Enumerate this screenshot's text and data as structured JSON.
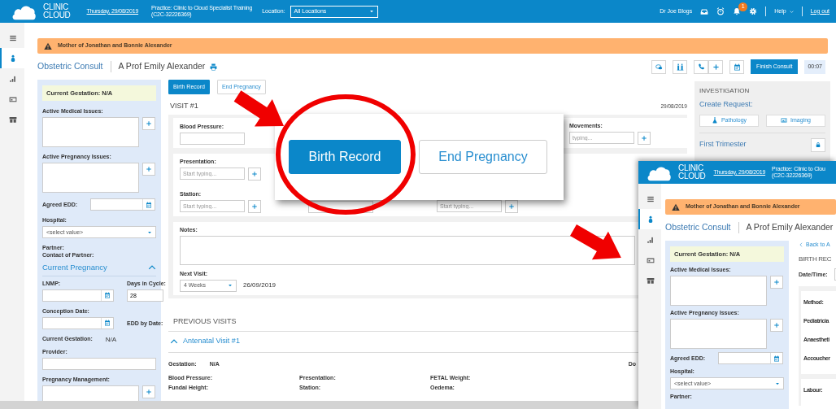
{
  "main": {
    "header": {
      "logo": [
        "CLINIC",
        "CLOUD"
      ],
      "date": "Thursday, 29/08/2019",
      "practice": [
        "Practice: Clinic to Cloud Specialist Training",
        "(C2C-32226369)"
      ],
      "location_label": "Location:",
      "location_value": "All Locations",
      "user": "Dr Joe Blogs",
      "notification_count": "1",
      "help": "Help",
      "logout": "Log out"
    },
    "side_nav": [
      {
        "kind": "menu",
        "selected": false
      },
      {
        "kind": "patient",
        "selected": true
      },
      {
        "kind": "chart",
        "selected": false
      },
      {
        "kind": "card",
        "selected": false
      },
      {
        "kind": "gift",
        "selected": false
      }
    ],
    "alert": "Mother of Jonathan and Bonnie Alexander",
    "consult": {
      "title": "Obstetric Consult",
      "patient": "A Prof Emily Alexander",
      "finish_button": "Finish Consult",
      "timer": "00:07"
    },
    "summary_panel": {
      "gestation": "Current Gestation: N/A",
      "items": [
        {
          "kind": "textarea",
          "label": "Active Medical Issues:"
        },
        {
          "kind": "textarea",
          "label": "Active Pregnancy Issues:"
        },
        {
          "kind": "date",
          "label": "Agreed EDD:"
        },
        {
          "kind": "select",
          "label": "Hospital:",
          "value": "<select value>"
        },
        {
          "kind": "label",
          "label": "Partner:"
        },
        {
          "kind": "label",
          "label": "Contact of Partner:"
        },
        {
          "kind": "section",
          "label": "Current Pregnancy",
          "expanded": true
        },
        {
          "kind": "pair",
          "label": "LNMP:",
          "label_2": "Days in Cycle:",
          "value": "28"
        },
        {
          "kind": "date_note",
          "label": "Conception Date:",
          "note": "EDD by Date:"
        },
        {
          "kind": "info",
          "label": "Current Gestation:",
          "value": "N/A"
        },
        {
          "kind": "text",
          "label": "Provider:"
        },
        {
          "kind": "textarea",
          "label": "Pregnancy Management:"
        }
      ]
    },
    "actions": [
      {
        "label": "Birth Record",
        "kind": "primary"
      },
      {
        "label": "End Pregnancy",
        "kind": "outline"
      }
    ],
    "visit": {
      "title": "VISIT #1",
      "date": "29/08/2019",
      "blocks": [
        {
          "kind": "grid",
          "rows": [
            [
              {
                "kind": "text",
                "label": "Blood Pressure:"
              },
              null,
              null,
              {
                "kind": "search",
                "label": "Movements:",
                "placeholder": "typing..."
              }
            ]
          ]
        },
        {
          "kind": "grid",
          "rows": [
            [
              {
                "kind": "search",
                "label": "Presentation:",
                "placeholder": "Start typing..."
              },
              null,
              null,
              null
            ],
            [
              {
                "kind": "search",
                "label": "Station:",
                "placeholder": "Start typing..."
              },
              {
                "kind": "text"
              },
              {
                "kind": "search",
                "placeholder": "Start typing..."
              },
              null
            ]
          ]
        },
        {
          "kind": "notes",
          "notes_label": "Notes:",
          "next_label": "Next Visit:",
          "next_value": "4 Weeks",
          "next_date": "26/09/2019"
        }
      ]
    },
    "previous_visits": {
      "title": "PREVIOUS VISITS",
      "visits": [
        {
          "title": "Antenatal Visit #1",
          "expanded": true,
          "gestation_label": "Gestation:",
          "gestation_value": "N/A",
          "side_text": "Do",
          "fields": [
            "Blood Pressure:",
            "Presentation:",
            "FETAL Weight:",
            "Fundal Height:",
            "Station:",
            "Oedema:"
          ]
        }
      ]
    },
    "investigation": {
      "title": "INVESTIGATION",
      "subtitle": "Create Request:",
      "buttons": [
        {
          "label": "Pathology",
          "kind": "pathology"
        },
        {
          "label": "Imaging",
          "kind": "imaging"
        }
      ],
      "section": "First Trimester"
    }
  },
  "callout": {
    "buttons": [
      {
        "label": "Birth Record",
        "kind": "primary"
      },
      {
        "label": "End Pregnancy",
        "kind": "outline"
      }
    ]
  },
  "inset": {
    "header": {
      "logo": [
        "CLINIC",
        "CLOUD"
      ],
      "date": "Thursday, 29/08/2019",
      "practice": [
        "Practice: Clinic to Clou",
        "(C2C-32226369)"
      ]
    },
    "side_nav": [
      {
        "kind": "menu",
        "selected": false
      },
      {
        "kind": "patient",
        "selected": true
      },
      {
        "kind": "chart",
        "selected": false
      },
      {
        "kind": "card",
        "selected": false
      },
      {
        "kind": "gift",
        "selected": false
      }
    ],
    "alert": "Mother of Jonathan and Bonnie Alexander",
    "consult": {
      "title": "Obstetric Consult",
      "patient": "A Prof Emily Alexander"
    },
    "summary_panel": {
      "gestation": "Current Gestation: N/A",
      "items": [
        {
          "kind": "textarea",
          "label": "Active Medical Issues:"
        },
        {
          "kind": "textarea",
          "label": "Active Pregnancy Issues:"
        },
        {
          "kind": "date",
          "label": "Agreed EDD:"
        },
        {
          "kind": "select",
          "label": "Hospital:",
          "value": "<select value>"
        },
        {
          "kind": "label",
          "label": "Partner:"
        }
      ]
    },
    "birth_record": {
      "back_link": "Back to A",
      "title": "BIRTH REC",
      "datetime_label": "Date/Time:",
      "details": [
        "Method:",
        "Pediatricia",
        "Anaestheti",
        "Accoucher"
      ],
      "labour": "Labour:"
    }
  }
}
